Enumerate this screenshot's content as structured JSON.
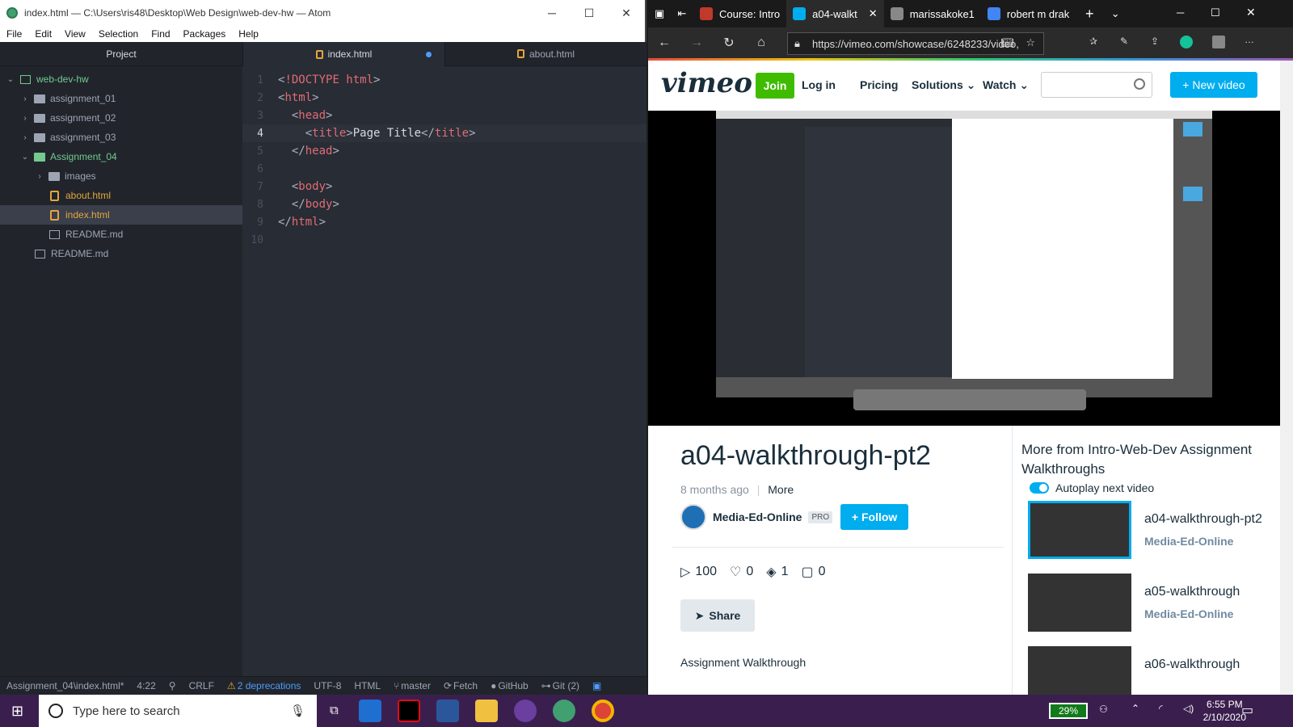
{
  "atom": {
    "window_title": "index.html — C:\\Users\\ris48\\Desktop\\Web Design\\web-dev-hw — Atom",
    "menu": [
      "File",
      "Edit",
      "View",
      "Selection",
      "Find",
      "Packages",
      "Help"
    ],
    "tree_header": "Project",
    "tree": [
      {
        "label": "web-dev-hw",
        "indent": 0,
        "kind": "repo",
        "open": true,
        "color": "green"
      },
      {
        "label": "assignment_01",
        "indent": 1,
        "kind": "folder",
        "open": false,
        "color": "normal"
      },
      {
        "label": "assignment_02",
        "indent": 1,
        "kind": "folder",
        "open": false,
        "color": "normal"
      },
      {
        "label": "assignment_03",
        "indent": 1,
        "kind": "folder",
        "open": false,
        "color": "normal"
      },
      {
        "label": "Assignment_04",
        "indent": 1,
        "kind": "folder",
        "open": true,
        "color": "green"
      },
      {
        "label": "images",
        "indent": 2,
        "kind": "folder",
        "open": false,
        "color": "normal"
      },
      {
        "label": "about.html",
        "indent": 2,
        "kind": "html",
        "color": "orange"
      },
      {
        "label": "index.html",
        "indent": 2,
        "kind": "html",
        "color": "orange",
        "selected": true
      },
      {
        "label": "README.md",
        "indent": 2,
        "kind": "md",
        "color": "normal"
      },
      {
        "label": "README.md",
        "indent": 1,
        "kind": "md",
        "color": "normal"
      }
    ],
    "tabs": [
      {
        "label": "index.html",
        "active": true,
        "modified": true
      },
      {
        "label": "about.html",
        "active": false
      }
    ],
    "code_lines": [
      {
        "n": "1",
        "html": "<span class='pu'>&lt;</span><span class='tg'>!DOCTYPE html</span><span class='pu'>&gt;</span>"
      },
      {
        "n": "2",
        "html": "<span class='pu'>&lt;</span><span class='tg'>html</span><span class='pu'>&gt;</span>"
      },
      {
        "n": "3",
        "html": "  <span class='pu'>&lt;</span><span class='tg'>head</span><span class='pu'>&gt;</span>"
      },
      {
        "n": "4",
        "html": "    <span class='pu'>&lt;</span><span class='tg'>title</span><span class='pu'>&gt;</span><span class='ct'>Page Title</span><span class='pu'>&lt;/</span><span class='tg'>title</span><span class='pu'>&gt;</span>",
        "current": true
      },
      {
        "n": "5",
        "html": "  <span class='pu'>&lt;/</span><span class='tg'>head</span><span class='pu'>&gt;</span>"
      },
      {
        "n": "6",
        "html": ""
      },
      {
        "n": "7",
        "html": "  <span class='pu'>&lt;</span><span class='tg'>body</span><span class='pu'>&gt;</span>"
      },
      {
        "n": "8",
        "html": "  <span class='pu'>&lt;/</span><span class='tg'>body</span><span class='pu'>&gt;</span>"
      },
      {
        "n": "9",
        "html": "<span class='pu'>&lt;/</span><span class='tg'>html</span><span class='pu'>&gt;</span>"
      },
      {
        "n": "10",
        "html": ""
      }
    ],
    "status": {
      "path": "Assignment_04\\index.html*",
      "cursor": "4:22",
      "line_ending": "CRLF",
      "deprecations": "2 deprecations",
      "encoding": "UTF-8",
      "grammar": "HTML",
      "branch": "master",
      "fetch": "Fetch",
      "github": "GitHub",
      "git": "Git (2)"
    }
  },
  "browser": {
    "tabs": [
      {
        "label": "Course: Intro",
        "icon_color": "#c0392b"
      },
      {
        "label": "a04-walkt",
        "icon_color": "#00adef",
        "active": true
      },
      {
        "label": "marissakoke1",
        "icon_color": "#888888"
      },
      {
        "label": "robert m drak",
        "icon_color": "#4285f4"
      }
    ],
    "url": "https://vimeo.com/showcase/6248233/video,",
    "vimeo": {
      "logo": "vimeo",
      "join": "Join",
      "nav": [
        "Log in",
        "Pricing",
        "Solutions ⌄",
        "Watch ⌄"
      ],
      "new_video": "+ New video",
      "title": "a04-walkthrough-pt2",
      "age": "8 months ago",
      "more": "More",
      "author": "Media-Ed-Online",
      "pro": "PRO",
      "follow": "+ Follow",
      "plays": "100",
      "likes": "0",
      "collections": "1",
      "comments": "0",
      "share": "Share",
      "description": "Assignment Walkthrough",
      "side_title": "More from Intro-Web-Dev Assignment Walkthroughs",
      "autoplay": "Autoplay next video",
      "side_videos": [
        {
          "title": "a04-walkthrough-pt2",
          "author": "Media-Ed-Online",
          "active": true
        },
        {
          "title": "a05-walkthrough",
          "author": "Media-Ed-Online"
        },
        {
          "title": "a06-walkthrough",
          "author": ""
        }
      ]
    }
  },
  "taskbar": {
    "search_placeholder": "Type here to search",
    "battery": "29%",
    "time": "6:55 PM",
    "date": "2/10/2020"
  }
}
